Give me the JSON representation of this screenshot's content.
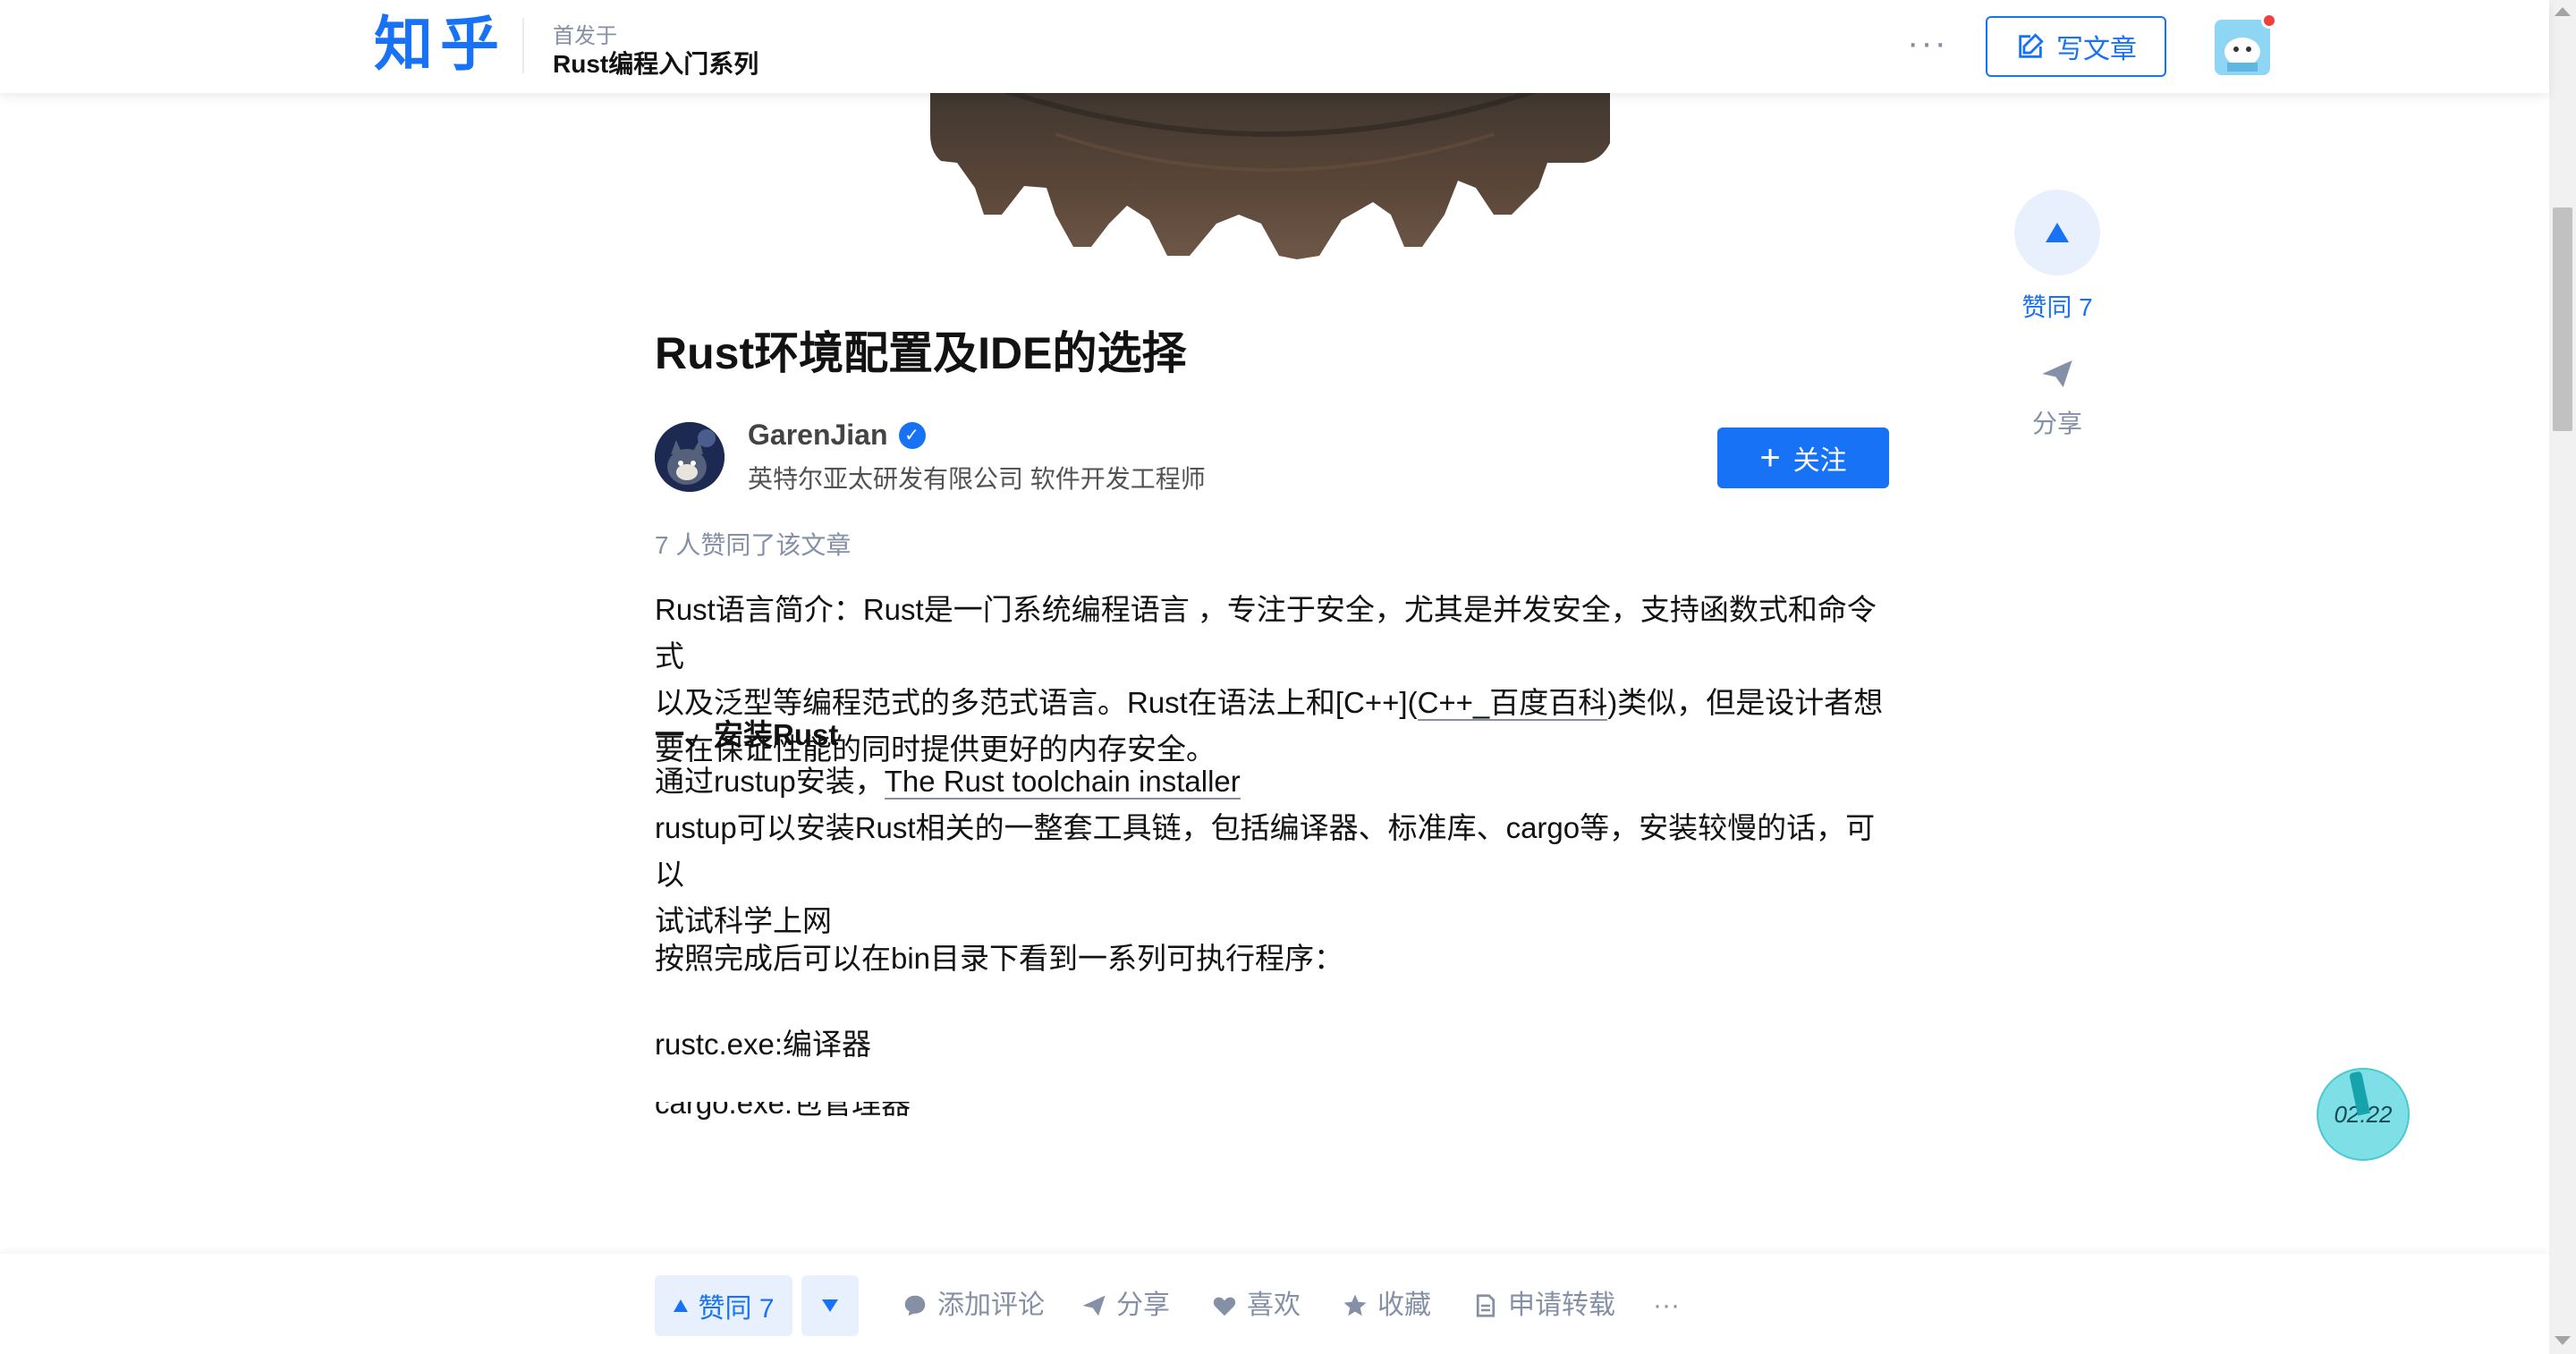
{
  "header": {
    "logo": "知乎",
    "publication_label": "首发于",
    "publication_title": "Rust编程入门系列",
    "more": "···",
    "write_label": "写文章"
  },
  "article": {
    "title": "Rust环境配置及IDE的选择",
    "author": {
      "name": "GarenJian",
      "bio": "英特尔亚太研发有限公司 软件开发工程师"
    },
    "follow_label": "关注",
    "vote_summary": "7 人赞同了该文章",
    "body": {
      "intro_line1": "Rust语言简介：Rust是一门系统编程语言 ，专注于安全，尤其是并发安全，支持函数式和命令式",
      "intro_line2_a": "以及泛型等编程范式的多范式语言。Rust在语法上和[C++](",
      "intro_line2_link": "C++_百度百科",
      "intro_line2_b": ")类似，但是设计者想",
      "intro_line3": "要在保证性能的同时提供更好的内存安全。",
      "section1": "一、安装Rust",
      "install_prefix": "通过rustup安装，",
      "install_link": "The Rust toolchain installer",
      "rustup_line1": "rustup可以安装Rust相关的一整套工具链，包括编译器、标准库、cargo等，安装较慢的话，可以",
      "rustup_line2": "试试科学上网",
      "bin_line": "按照完成后可以在bin目录下看到一系列可执行程序：",
      "rustc_line": "rustc.exe:编译器",
      "cut_line": "cargo.exe:包管理器"
    }
  },
  "side_actions": {
    "vote_label": "赞同 7",
    "share_label": "分享"
  },
  "timer": "02:22",
  "bottom_actions": {
    "vote_up": "赞同 7",
    "comment": "添加评论",
    "share": "分享",
    "like": "喜欢",
    "collect": "收藏",
    "repost": "申请转载",
    "more": "···"
  },
  "colors": {
    "brand": "#1772f6",
    "muted": "#8590a6",
    "vote_bg": "#e8f0fd"
  }
}
